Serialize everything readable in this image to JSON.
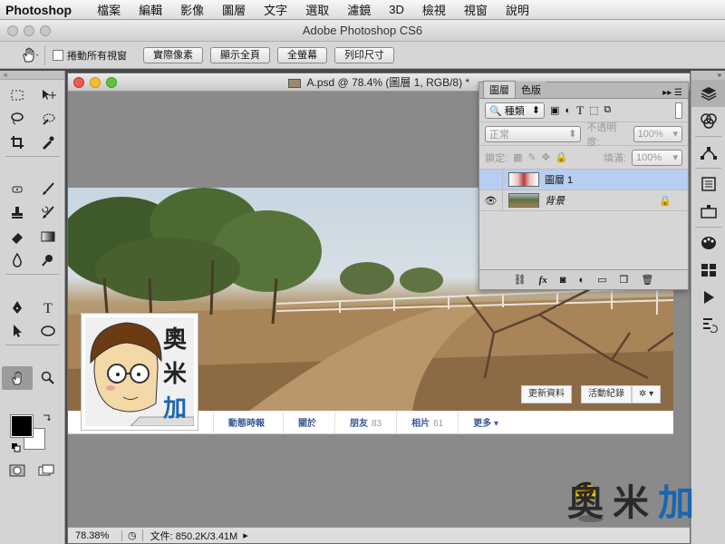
{
  "menubar": {
    "app": "Photoshop",
    "items": [
      "檔案",
      "編輯",
      "影像",
      "圖層",
      "文字",
      "選取",
      "濾鏡",
      "3D",
      "檢視",
      "視窗",
      "說明"
    ]
  },
  "window_title": "Adobe Photoshop CS6",
  "options": {
    "scroll_all_label": "捲動所有視窗",
    "buttons": [
      "實際像素",
      "顯示全頁",
      "全螢幕",
      "列印尺寸"
    ]
  },
  "document": {
    "title": "A.psd @ 78.4% (圖層 1, RGB/8) *",
    "zoom": "78.38%",
    "doc_size": "文件: 850.2K/3.41M"
  },
  "facebook": {
    "tabs": [
      {
        "label": "動態時報",
        "count": ""
      },
      {
        "label": "關於",
        "count": ""
      },
      {
        "label": "朋友",
        "count": "83"
      },
      {
        "label": "相片",
        "count": "61"
      },
      {
        "label": "更多 ▾",
        "count": ""
      }
    ],
    "update_info": "更新資料",
    "activity_log": "活動紀錄",
    "gear": "✲ ▾",
    "avatar_text": [
      "奧",
      "米",
      "加"
    ]
  },
  "layers_panel": {
    "tabs": [
      "圖層",
      "色版"
    ],
    "filter_kind": "種類",
    "blend_mode": "正常",
    "opacity_label": "不透明度:",
    "opacity_value": "100%",
    "lock_label": "鎖定:",
    "fill_label": "填滿:",
    "fill_value": "100%",
    "layers": [
      {
        "name": "圖層 1",
        "selected": true,
        "visible": false,
        "locked": false
      },
      {
        "name": "背景",
        "selected": false,
        "visible": true,
        "locked": true
      }
    ]
  },
  "watermark": [
    "奧",
    "米",
    "加"
  ],
  "colors": {
    "selection": "#b7cef2",
    "fb_link": "#3b5998"
  }
}
